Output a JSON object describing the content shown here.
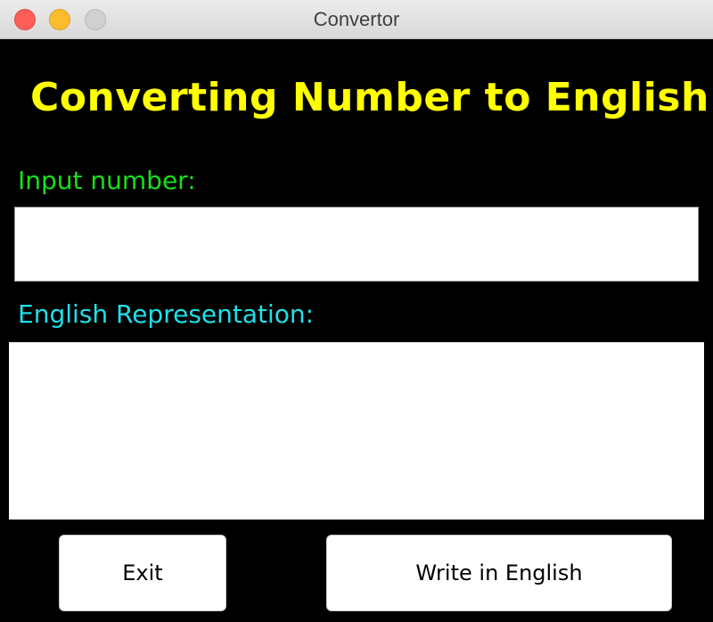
{
  "window": {
    "title": "Convertor",
    "controls": [
      "close-icon",
      "minimize-icon",
      "maximize-icon"
    ]
  },
  "main": {
    "heading": "Converting Number to English",
    "input_label": "Input number:",
    "input_value": "",
    "output_label": "English Representation:",
    "output_value": ""
  },
  "buttons": {
    "exit_label": "Exit",
    "write_label": "Write in English"
  },
  "colors": {
    "background": "#000000",
    "heading": "#ffff00",
    "input_label": "#18e018",
    "output_label": "#1ee0e8"
  }
}
